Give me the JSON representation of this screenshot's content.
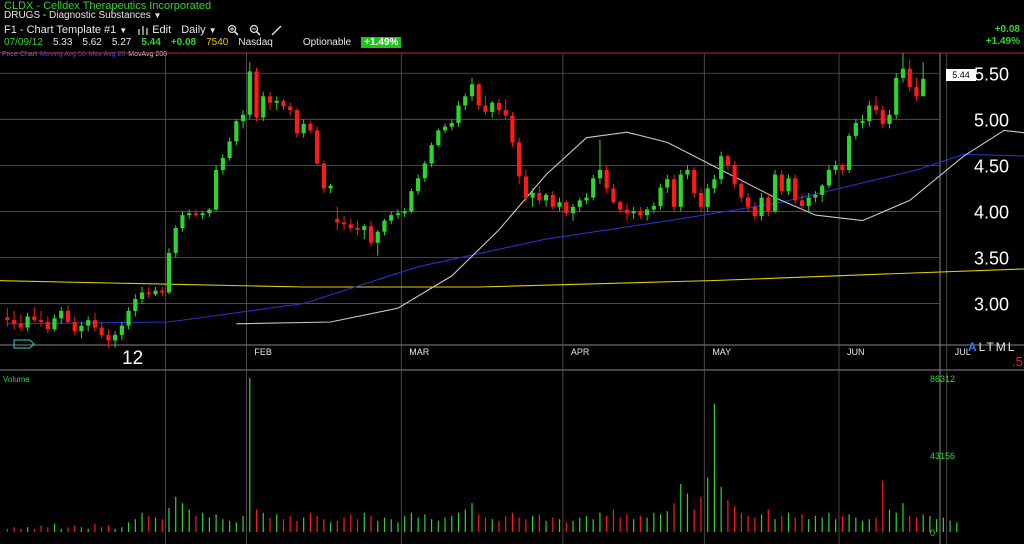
{
  "header": {
    "title": "CLDX - Celldex Therapeutics Incorporated",
    "sector": "DRUGS - Diagnostic Substances"
  },
  "toolbar": {
    "template_label": "F1 - Chart Template #1",
    "edit_label": "Edit",
    "period_label": "Daily"
  },
  "quote": {
    "date": "07/09/12",
    "open": "5.33",
    "high": "5.62",
    "low": "5.27",
    "last": "5.44",
    "change": "+0.08",
    "volume": "7540",
    "exchange": "Nasdaq",
    "optionable": "Optionable",
    "pct_change": "+1.49%"
  },
  "change_box": {
    "abs": "+0.08",
    "pct": "+1.49%"
  },
  "legend": {
    "price": "Price Chart",
    "ma20": "Moving Avg 50",
    "ma50": "Mov Avg 20",
    "ma200": "MovAvg 200"
  },
  "overlay": {
    "altml_a": "A",
    "altml_rest": "LTML",
    "five": ".5",
    "year": "12",
    "price_tag": "5.44",
    "volume_label": "Volume"
  },
  "colors": {
    "up": "#2fd52f",
    "down": "#ff1a1a",
    "ma_short": "#c8c8c8",
    "ma_mid": "#2233cc",
    "ma_long": "#e0d000",
    "grid": "#5a5a5a"
  },
  "chart_data": {
    "type": "candlestick",
    "price_axis": {
      "ticks": [
        "5.50",
        "5.00",
        "4.50",
        "4.00",
        "3.50",
        "3.00"
      ],
      "values": [
        5.5,
        5.0,
        4.5,
        4.0,
        3.5,
        3.0
      ],
      "range": [
        2.55,
        5.72
      ]
    },
    "month_labels": [
      "FEB",
      "MAR",
      "APR",
      "MAY",
      "JUN",
      "JUL"
    ],
    "volume_axis": {
      "ticks": [
        "86312",
        "43156",
        "0"
      ],
      "values": [
        86312,
        43156,
        0
      ],
      "max": 86312
    },
    "candles": [
      [
        2.85,
        2.95,
        2.75,
        2.82
      ],
      [
        2.82,
        2.92,
        2.72,
        2.78
      ],
      [
        2.78,
        2.88,
        2.7,
        2.74
      ],
      [
        2.74,
        2.9,
        2.7,
        2.86
      ],
      [
        2.86,
        2.96,
        2.8,
        2.82
      ],
      [
        2.82,
        2.92,
        2.75,
        2.8
      ],
      [
        2.8,
        2.86,
        2.68,
        2.72
      ],
      [
        2.72,
        2.88,
        2.7,
        2.84
      ],
      [
        2.84,
        2.96,
        2.78,
        2.92
      ],
      [
        2.92,
        2.98,
        2.78,
        2.8
      ],
      [
        2.8,
        2.86,
        2.66,
        2.7
      ],
      [
        2.7,
        2.8,
        2.62,
        2.76
      ],
      [
        2.76,
        2.86,
        2.7,
        2.82
      ],
      [
        2.82,
        2.9,
        2.7,
        2.74
      ],
      [
        2.74,
        2.8,
        2.62,
        2.66
      ],
      [
        2.66,
        2.72,
        2.52,
        2.6
      ],
      [
        2.6,
        2.7,
        2.52,
        2.66
      ],
      [
        2.66,
        2.8,
        2.6,
        2.76
      ],
      [
        2.76,
        2.96,
        2.72,
        2.92
      ],
      [
        2.92,
        3.1,
        2.86,
        3.05
      ],
      [
        3.05,
        3.18,
        3.0,
        3.12
      ],
      [
        3.12,
        3.18,
        3.06,
        3.1
      ],
      [
        3.1,
        3.18,
        3.08,
        3.14
      ],
      [
        3.14,
        3.18,
        3.08,
        3.12
      ],
      [
        3.12,
        3.6,
        3.1,
        3.55
      ],
      [
        3.55,
        3.85,
        3.5,
        3.82
      ],
      [
        3.82,
        4.0,
        3.78,
        3.96
      ],
      [
        3.96,
        4.02,
        3.92,
        3.98
      ],
      [
        3.98,
        4.02,
        3.94,
        3.96
      ],
      [
        3.96,
        4.0,
        3.92,
        3.98
      ],
      [
        3.98,
        4.04,
        3.94,
        4.02
      ],
      [
        4.02,
        4.5,
        4.0,
        4.45
      ],
      [
        4.45,
        4.62,
        4.4,
        4.58
      ],
      [
        4.58,
        4.8,
        4.55,
        4.76
      ],
      [
        4.76,
        5.0,
        4.72,
        4.98
      ],
      [
        4.98,
        5.1,
        4.9,
        5.05
      ],
      [
        5.05,
        5.62,
        5.0,
        5.52
      ],
      [
        5.52,
        5.56,
        4.98,
        5.02
      ],
      [
        5.02,
        5.3,
        4.98,
        5.25
      ],
      [
        5.25,
        5.3,
        5.1,
        5.18
      ],
      [
        5.18,
        5.25,
        5.1,
        5.2
      ],
      [
        5.2,
        5.22,
        5.1,
        5.14
      ],
      [
        5.14,
        5.18,
        5.04,
        5.1
      ],
      [
        5.1,
        5.12,
        4.8,
        4.85
      ],
      [
        4.85,
        5.0,
        4.8,
        4.95
      ],
      [
        4.95,
        4.98,
        4.85,
        4.88
      ],
      [
        4.88,
        4.92,
        4.5,
        4.52
      ],
      [
        4.52,
        4.55,
        4.2,
        4.25
      ],
      [
        4.25,
        4.3,
        4.2,
        4.28
      ],
      [
        3.92,
        4.05,
        3.8,
        3.88
      ],
      [
        3.88,
        3.95,
        3.8,
        3.86
      ],
      [
        3.86,
        3.92,
        3.78,
        3.82
      ],
      [
        3.82,
        3.9,
        3.74,
        3.8
      ],
      [
        3.8,
        3.86,
        3.7,
        3.84
      ],
      [
        3.84,
        3.9,
        3.62,
        3.66
      ],
      [
        3.66,
        3.8,
        3.52,
        3.78
      ],
      [
        3.78,
        3.92,
        3.74,
        3.9
      ],
      [
        3.9,
        4.0,
        3.86,
        3.96
      ],
      [
        3.96,
        4.02,
        3.92,
        3.98
      ],
      [
        3.98,
        4.04,
        3.94,
        4.0
      ],
      [
        4.0,
        4.25,
        3.98,
        4.22
      ],
      [
        4.22,
        4.4,
        4.18,
        4.36
      ],
      [
        4.36,
        4.55,
        4.32,
        4.52
      ],
      [
        4.52,
        4.75,
        4.48,
        4.72
      ],
      [
        4.72,
        4.9,
        4.7,
        4.88
      ],
      [
        4.88,
        4.95,
        4.85,
        4.92
      ],
      [
        4.92,
        5.0,
        4.88,
        4.96
      ],
      [
        4.96,
        5.2,
        4.92,
        5.15
      ],
      [
        5.15,
        5.28,
        5.1,
        5.25
      ],
      [
        5.25,
        5.45,
        5.2,
        5.38
      ],
      [
        5.38,
        5.4,
        5.1,
        5.15
      ],
      [
        5.15,
        5.25,
        5.05,
        5.08
      ],
      [
        5.08,
        5.2,
        5.02,
        5.18
      ],
      [
        5.18,
        5.22,
        5.05,
        5.1
      ],
      [
        5.1,
        5.22,
        5.0,
        5.04
      ],
      [
        5.04,
        5.08,
        4.7,
        4.75
      ],
      [
        4.75,
        4.8,
        4.3,
        4.38
      ],
      [
        4.38,
        4.45,
        4.1,
        4.15
      ],
      [
        4.15,
        4.25,
        4.05,
        4.2
      ],
      [
        4.2,
        4.28,
        4.08,
        4.12
      ],
      [
        4.12,
        4.2,
        4.05,
        4.18
      ],
      [
        4.18,
        4.22,
        4.02,
        4.05
      ],
      [
        4.05,
        4.15,
        4.0,
        4.1
      ],
      [
        4.1,
        4.12,
        3.95,
        3.98
      ],
      [
        3.98,
        4.08,
        3.9,
        4.05
      ],
      [
        4.05,
        4.15,
        4.0,
        4.12
      ],
      [
        4.12,
        4.2,
        4.08,
        4.15
      ],
      [
        4.15,
        4.4,
        4.12,
        4.36
      ],
      [
        4.36,
        4.78,
        4.3,
        4.45
      ],
      [
        4.45,
        4.5,
        4.2,
        4.25
      ],
      [
        4.25,
        4.3,
        4.08,
        4.1
      ],
      [
        4.1,
        4.12,
        3.98,
        4.02
      ],
      [
        4.02,
        4.08,
        3.9,
        3.98
      ],
      [
        3.98,
        4.05,
        3.92,
        4.0
      ],
      [
        4.0,
        4.05,
        3.92,
        3.96
      ],
      [
        3.96,
        4.05,
        3.9,
        4.02
      ],
      [
        4.02,
        4.1,
        3.98,
        4.06
      ],
      [
        4.06,
        4.3,
        4.02,
        4.26
      ],
      [
        4.26,
        4.4,
        4.2,
        4.35
      ],
      [
        4.35,
        4.4,
        4.0,
        4.05
      ],
      [
        4.05,
        4.45,
        4.0,
        4.4
      ],
      [
        4.4,
        4.5,
        4.35,
        4.45
      ],
      [
        4.45,
        4.48,
        4.15,
        4.2
      ],
      [
        4.2,
        4.25,
        4.0,
        4.05
      ],
      [
        4.05,
        4.3,
        4.0,
        4.25
      ],
      [
        4.25,
        4.4,
        4.2,
        4.35
      ],
      [
        4.35,
        4.65,
        4.3,
        4.6
      ],
      [
        4.6,
        4.62,
        4.45,
        4.5
      ],
      [
        4.5,
        4.55,
        4.25,
        4.3
      ],
      [
        4.3,
        4.35,
        4.1,
        4.15
      ],
      [
        4.15,
        4.2,
        4.0,
        4.05
      ],
      [
        4.05,
        4.1,
        3.9,
        3.95
      ],
      [
        3.95,
        4.2,
        3.9,
        4.15
      ],
      [
        4.15,
        4.2,
        3.95,
        4.0
      ],
      [
        4.0,
        4.45,
        3.98,
        4.4
      ],
      [
        4.4,
        4.45,
        4.18,
        4.22
      ],
      [
        4.22,
        4.4,
        4.18,
        4.36
      ],
      [
        4.36,
        4.4,
        4.08,
        4.12
      ],
      [
        4.12,
        4.18,
        4.02,
        4.06
      ],
      [
        4.06,
        4.2,
        4.0,
        4.15
      ],
      [
        4.15,
        4.22,
        4.1,
        4.18
      ],
      [
        4.18,
        4.3,
        4.1,
        4.28
      ],
      [
        4.28,
        4.5,
        4.25,
        4.45
      ],
      [
        4.45,
        4.55,
        4.4,
        4.5
      ],
      [
        4.5,
        4.52,
        4.4,
        4.45
      ],
      [
        4.45,
        4.85,
        4.42,
        4.82
      ],
      [
        4.82,
        5.0,
        4.78,
        4.96
      ],
      [
        4.96,
        5.05,
        4.9,
        4.98
      ],
      [
        4.98,
        5.2,
        4.92,
        5.15
      ],
      [
        5.15,
        5.25,
        5.05,
        5.1
      ],
      [
        5.1,
        5.15,
        4.9,
        4.95
      ],
      [
        4.95,
        5.1,
        4.9,
        5.05
      ],
      [
        5.05,
        5.5,
        5.0,
        5.45
      ],
      [
        5.45,
        5.72,
        5.4,
        5.55
      ],
      [
        5.55,
        5.65,
        5.3,
        5.35
      ],
      [
        5.35,
        5.45,
        5.2,
        5.25
      ],
      [
        5.25,
        5.62,
        5.27,
        5.44
      ]
    ],
    "ma_short": [
      [
        2.78,
        34
      ],
      [
        2.8,
        48
      ],
      [
        2.95,
        58
      ],
      [
        3.3,
        66
      ],
      [
        3.8,
        73
      ],
      [
        4.4,
        80
      ],
      [
        4.8,
        86
      ],
      [
        4.86,
        92
      ],
      [
        4.75,
        98
      ],
      [
        4.45,
        106
      ],
      [
        4.15,
        114
      ],
      [
        3.96,
        120
      ],
      [
        3.9,
        127
      ],
      [
        4.12,
        134
      ],
      [
        4.6,
        142
      ],
      [
        4.88,
        148
      ],
      [
        4.8,
        157
      ],
      [
        4.4,
        165
      ],
      [
        4.15,
        173
      ],
      [
        4.05,
        181
      ],
      [
        4.18,
        189
      ],
      [
        4.4,
        197
      ],
      [
        4.45,
        205
      ],
      [
        4.25,
        213
      ],
      [
        4.18,
        221
      ],
      [
        4.1,
        229
      ],
      [
        4.25,
        237
      ],
      [
        4.42,
        245
      ],
      [
        4.8,
        252
      ]
    ],
    "ma_mid": [
      [
        2.78,
        0
      ],
      [
        2.8,
        24
      ],
      [
        3.0,
        44
      ],
      [
        3.4,
        61
      ],
      [
        3.7,
        80
      ],
      [
        3.92,
        100
      ],
      [
        4.1,
        115
      ],
      [
        4.45,
        135
      ],
      [
        4.62,
        142
      ],
      [
        4.6,
        152
      ],
      [
        4.48,
        165
      ],
      [
        4.38,
        178
      ],
      [
        4.38,
        195
      ],
      [
        4.3,
        215
      ],
      [
        4.3,
        233
      ],
      [
        4.38,
        245
      ],
      [
        4.48,
        252
      ]
    ],
    "ma_long": [
      [
        3.28,
        -22
      ],
      [
        3.18,
        44
      ],
      [
        3.18,
        70
      ],
      [
        3.25,
        105
      ],
      [
        3.32,
        130
      ],
      [
        3.4,
        160
      ],
      [
        3.5,
        195
      ],
      [
        3.62,
        225
      ],
      [
        3.78,
        252
      ]
    ],
    "volume": [
      2,
      3,
      2,
      3,
      2,
      4,
      3,
      5,
      2,
      3,
      4,
      3,
      2,
      5,
      3,
      4,
      2,
      3,
      6,
      8,
      12,
      10,
      9,
      8,
      15,
      22,
      18,
      14,
      10,
      12,
      9,
      11,
      8,
      7,
      6,
      10,
      96,
      14,
      12,
      9,
      11,
      8,
      10,
      7,
      9,
      12,
      10,
      8,
      6,
      7,
      9,
      11,
      8,
      12,
      10,
      7,
      9,
      8,
      6,
      10,
      12,
      9,
      11,
      8,
      7,
      9,
      10,
      12,
      14,
      18,
      11,
      9,
      8,
      7,
      10,
      12,
      9,
      8,
      10,
      11,
      7,
      9,
      8,
      6,
      7,
      9,
      10,
      8,
      12,
      10,
      14,
      9,
      11,
      8,
      10,
      9,
      12,
      11,
      13,
      18,
      30,
      24,
      14,
      22,
      34,
      80,
      28,
      20,
      16,
      12,
      10,
      9,
      11,
      14,
      8,
      10,
      12,
      9,
      11,
      8,
      10,
      9,
      12,
      8,
      10,
      11,
      9,
      7,
      8,
      9,
      32,
      14,
      12,
      18,
      10,
      9,
      11,
      10,
      8,
      9,
      7,
      6
    ]
  }
}
